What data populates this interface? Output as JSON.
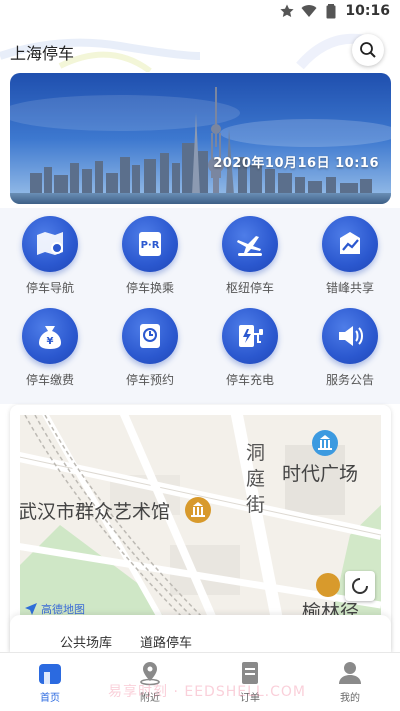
{
  "status_bar": {
    "time": "10:16"
  },
  "header": {
    "city": "上海停车"
  },
  "banner": {
    "datetime": "2020年10月16日  10:16"
  },
  "services": [
    {
      "label": "停车导航",
      "icon": "map-pin-icon"
    },
    {
      "label": "停车换乘",
      "icon": "park-ride-icon"
    },
    {
      "label": "枢纽停车",
      "icon": "plane-train-icon"
    },
    {
      "label": "错峰共享",
      "icon": "chart-up-icon"
    },
    {
      "label": "停车缴费",
      "icon": "money-bag-icon"
    },
    {
      "label": "停车预约",
      "icon": "clock-doc-icon"
    },
    {
      "label": "停车充电",
      "icon": "charging-icon"
    },
    {
      "label": "服务公告",
      "icon": "speaker-icon"
    }
  ],
  "map": {
    "poi_times_square": "时代广场",
    "poi_art_museum": "武汉市群众艺术馆",
    "road_dongting": "洞庭街",
    "poi_partial": "榆林径",
    "provider": "高德地图"
  },
  "parking_tabs": {
    "public": "公共场库",
    "road": "道路停车"
  },
  "nav": {
    "home": "首页",
    "nearby": "附近",
    "orders": "订单",
    "mine": "我的"
  },
  "watermark": "易享时刻 · EEDSHELL.COM",
  "colors": {
    "primary": "#2b58cf",
    "active_nav": "#2b6ae0"
  }
}
